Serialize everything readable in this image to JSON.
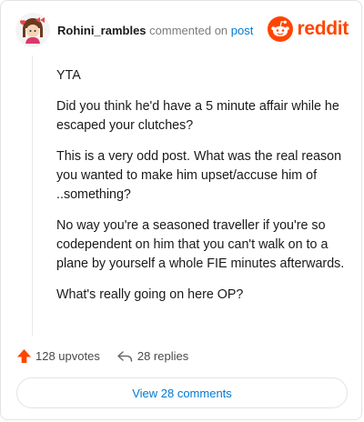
{
  "header": {
    "username": "Rohini_rambles",
    "commented_text": "commented on",
    "post_link": "post"
  },
  "brand": {
    "icon": "reddit-alien-icon",
    "name": "reddit",
    "color": "#ff4500"
  },
  "comment": {
    "paragraphs": [
      "YTA",
      "Did you think he'd have a 5 minute affair while he escaped your clutches?",
      "This is a very odd post. What was the real reason you wanted to make him upset/accuse him of ..something?",
      "No way you're a seasoned traveller if you're so codependent on him that you can't walk on to a plane by yourself a whole FIE minutes afterwards.",
      "What's really going on here OP?"
    ]
  },
  "stats": {
    "upvotes_icon": "upvote-arrow-icon",
    "upvotes": "128 upvotes",
    "replies_icon": "reply-arrow-icon",
    "replies": "28 replies"
  },
  "view_comments_label": "View 28 comments",
  "colors": {
    "accent": "#0079d3",
    "upvote": "#ff4500",
    "muted": "#7c7c7c"
  }
}
